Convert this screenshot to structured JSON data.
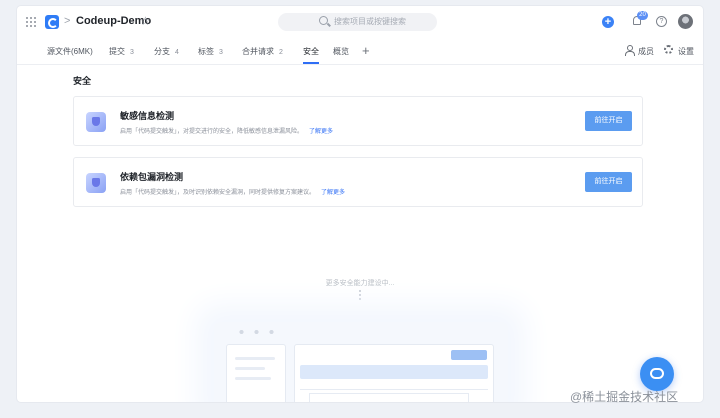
{
  "header": {
    "repo_name": "Codeup-Demo",
    "separator": ">",
    "search_placeholder": "搜索项目或按键搜索",
    "notification_count": "20",
    "help_glyph": "?",
    "add_glyph": "+",
    "star_glyph": "☆"
  },
  "tabs": [
    {
      "label": "源文件(6MK)",
      "count": ""
    },
    {
      "label": "提交",
      "count": "3"
    },
    {
      "label": "分支",
      "count": "4"
    },
    {
      "label": "标签",
      "count": "3"
    },
    {
      "label": "合并请求",
      "count": "2"
    },
    {
      "label": "安全",
      "count": ""
    },
    {
      "label": "概览",
      "count": ""
    }
  ],
  "tab_add": "+",
  "tab_right": {
    "members": "成员",
    "settings": "设置"
  },
  "section_title": "安全",
  "cards": [
    {
      "title": "敏感信息检测",
      "desc": "启用「代码提交触发」，对提交进行的安全，降低敏感信息泄漏风险。",
      "link": "了解更多",
      "button": "前往开启"
    },
    {
      "title": "依赖包漏洞检测",
      "desc": "启用「代码提交触发」，及时识别依赖安全漏洞，同时提供修复方案建议。",
      "link": "了解更多",
      "button": "前往开启"
    }
  ],
  "more_text": "更多安全能力建设中...",
  "watermark": "@稀土掘金技术社区",
  "colors": {
    "accent": "#2f6ef5",
    "button": "#5b9cf0",
    "fab": "#3b8ff3"
  }
}
